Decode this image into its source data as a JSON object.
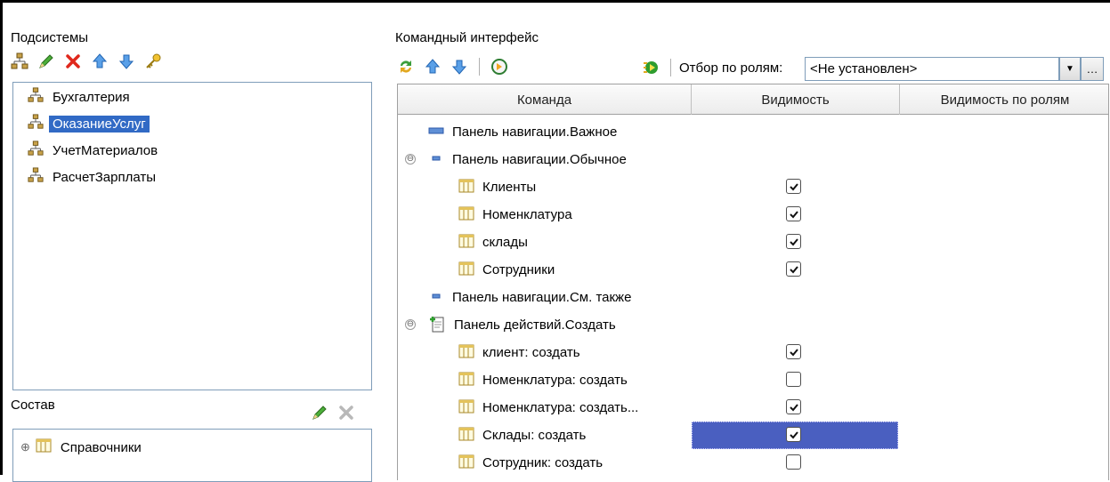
{
  "subsystems": {
    "title": "Подсистемы",
    "toolbar_icons": [
      "subsystem-tree-icon",
      "pencil-icon",
      "delete-x-icon",
      "arrow-up-icon",
      "arrow-down-icon",
      "key-icon"
    ],
    "items": [
      {
        "label": "Бухгалтерия",
        "selected": false
      },
      {
        "label": "ОказаниеУслуг",
        "selected": true
      },
      {
        "label": "УчетМатериалов",
        "selected": false
      },
      {
        "label": "РасчетЗарплаты",
        "selected": false
      }
    ]
  },
  "composition": {
    "title": "Состав",
    "items": [
      {
        "label": "Справочники",
        "expander": "⊕"
      }
    ]
  },
  "command_interface": {
    "title": "Командный интерфейс",
    "role_filter_label": "Отбор по ролям:",
    "role_filter_value": "<Не установлен>",
    "columns": [
      "Команда",
      "Видимость",
      "Видимость по ролям"
    ],
    "rows": [
      {
        "label": "Панель навигации.Важное",
        "kind": "panel-blue",
        "level": 0,
        "expander": null,
        "checked": null
      },
      {
        "label": "Панель навигации.Обычное",
        "kind": "panel-minus",
        "level": 0,
        "expander": "⊖",
        "checked": null
      },
      {
        "label": "Клиенты",
        "kind": "catalog",
        "level": 1,
        "expander": null,
        "checked": true
      },
      {
        "label": "Номенклатура",
        "kind": "catalog",
        "level": 1,
        "expander": null,
        "checked": true
      },
      {
        "label": "склады",
        "kind": "catalog",
        "level": 1,
        "expander": null,
        "checked": true
      },
      {
        "label": "Сотрудники",
        "kind": "catalog",
        "level": 1,
        "expander": null,
        "checked": true
      },
      {
        "label": "Панель навигации.См. также",
        "kind": "panel-minus",
        "level": 0,
        "expander": null,
        "checked": null
      },
      {
        "label": "Панель действий.Создать",
        "kind": "create-doc",
        "level": 0,
        "expander": "⊖",
        "checked": null
      },
      {
        "label": "клиент: создать",
        "kind": "catalog",
        "level": 1,
        "expander": null,
        "checked": true
      },
      {
        "label": "Номенклатура: создать",
        "kind": "catalog",
        "level": 1,
        "expander": null,
        "checked": false
      },
      {
        "label": "Номенклатура: создать...",
        "kind": "catalog",
        "level": 1,
        "expander": null,
        "checked": true
      },
      {
        "label": "Склады: создать",
        "kind": "catalog",
        "level": 1,
        "expander": null,
        "checked": true,
        "selected_visibility": true
      },
      {
        "label": "Сотрудник: создать",
        "kind": "catalog",
        "level": 1,
        "expander": null,
        "checked": false
      }
    ]
  },
  "colors": {
    "selection": "#316ac5",
    "cell_selection": "#4a5fc0",
    "border": "#7f9db9"
  }
}
